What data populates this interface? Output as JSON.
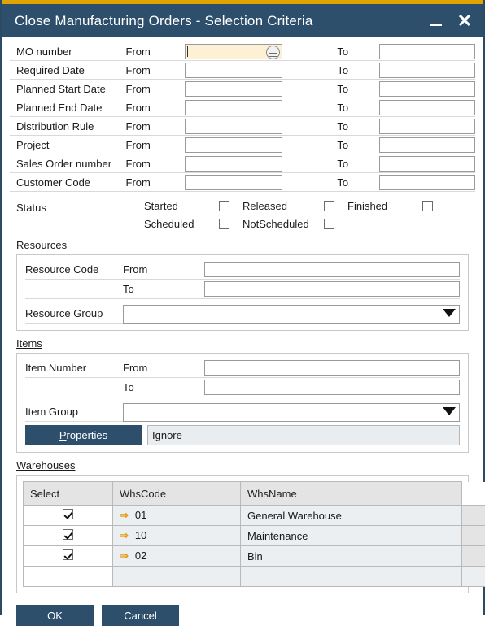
{
  "window": {
    "title": "Close Manufacturing Orders - Selection Criteria",
    "minimize_label": "Minimize",
    "close_label": "Close",
    "accent_gold": "#e0a400",
    "titlebar_color": "#2d4f6c"
  },
  "criteria": {
    "from_label": "From",
    "to_label": "To",
    "rows": [
      {
        "label": "MO number",
        "from_value": "",
        "to_value": "",
        "focused": true,
        "has_list_button": true
      },
      {
        "label": "Required Date",
        "from_value": "",
        "to_value": "",
        "focused": false,
        "has_list_button": false
      },
      {
        "label": "Planned Start Date",
        "from_value": "",
        "to_value": "",
        "focused": false,
        "has_list_button": false
      },
      {
        "label": "Planned End Date",
        "from_value": "",
        "to_value": "",
        "focused": false,
        "has_list_button": false
      },
      {
        "label": "Distribution Rule",
        "from_value": "",
        "to_value": "",
        "focused": false,
        "has_list_button": false
      },
      {
        "label": "Project",
        "from_value": "",
        "to_value": "",
        "focused": false,
        "has_list_button": false
      },
      {
        "label": "Sales Order number",
        "from_value": "",
        "to_value": "",
        "focused": false,
        "has_list_button": false
      },
      {
        "label": "Customer Code",
        "from_value": "",
        "to_value": "",
        "focused": false,
        "has_list_button": false
      }
    ]
  },
  "status": {
    "label": "Status",
    "row1": [
      {
        "label": "Started",
        "checked": false
      },
      {
        "label": "Released",
        "checked": false
      },
      {
        "label": "Finished",
        "checked": false
      }
    ],
    "row2": [
      {
        "label": "Scheduled",
        "checked": false
      },
      {
        "label": "NotScheduled",
        "checked": false
      }
    ]
  },
  "resources": {
    "heading": "Resources",
    "code_label": "Resource Code",
    "from_label": "From",
    "to_label": "To",
    "code_from_value": "",
    "code_to_value": "",
    "group_label": "Resource Group",
    "group_value": ""
  },
  "items": {
    "heading": "Items",
    "number_label": "Item Number",
    "from_label": "From",
    "to_label": "To",
    "number_from_value": "",
    "number_to_value": "",
    "group_label": "Item Group",
    "group_value": "",
    "properties_button": "Properties",
    "properties_accel": "P",
    "properties_rest": "roperties",
    "properties_value": "Ignore"
  },
  "warehouses": {
    "heading": "Warehouses",
    "columns": [
      "Select",
      "WhsCode",
      "WhsName"
    ],
    "rows": [
      {
        "selected": true,
        "code": "01",
        "name": "General Warehouse"
      },
      {
        "selected": true,
        "code": "10",
        "name": "Maintenance"
      },
      {
        "selected": true,
        "code": "02",
        "name": "Bin"
      }
    ],
    "empty_row": {
      "selected": false,
      "code": "",
      "name": ""
    },
    "link_arrow": "⇒",
    "link_arrow_color": "#e39c12"
  },
  "footer": {
    "ok_label": "OK",
    "cancel_label": "Cancel"
  }
}
